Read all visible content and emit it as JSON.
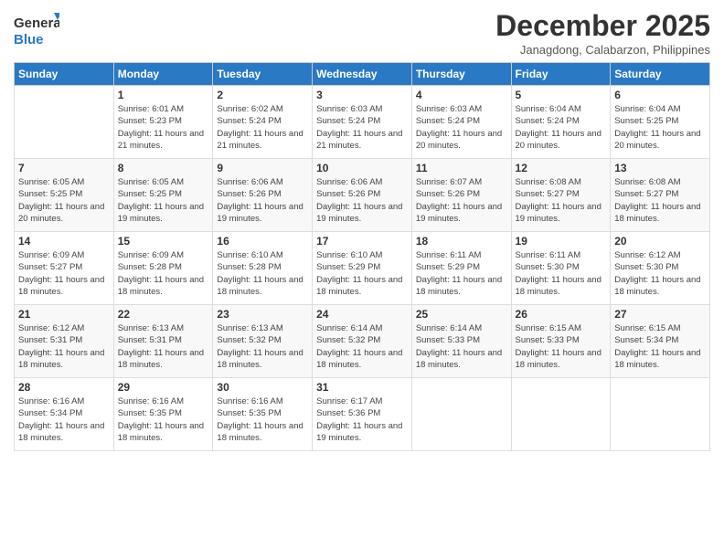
{
  "header": {
    "logo_general": "General",
    "logo_blue": "Blue",
    "month": "December 2025",
    "location": "Janagdong, Calabarzon, Philippines"
  },
  "days_of_week": [
    "Sunday",
    "Monday",
    "Tuesday",
    "Wednesday",
    "Thursday",
    "Friday",
    "Saturday"
  ],
  "weeks": [
    [
      {
        "day": "",
        "sunrise": "",
        "sunset": "",
        "daylight": ""
      },
      {
        "day": "1",
        "sunrise": "Sunrise: 6:01 AM",
        "sunset": "Sunset: 5:23 PM",
        "daylight": "Daylight: 11 hours and 21 minutes."
      },
      {
        "day": "2",
        "sunrise": "Sunrise: 6:02 AM",
        "sunset": "Sunset: 5:24 PM",
        "daylight": "Daylight: 11 hours and 21 minutes."
      },
      {
        "day": "3",
        "sunrise": "Sunrise: 6:03 AM",
        "sunset": "Sunset: 5:24 PM",
        "daylight": "Daylight: 11 hours and 21 minutes."
      },
      {
        "day": "4",
        "sunrise": "Sunrise: 6:03 AM",
        "sunset": "Sunset: 5:24 PM",
        "daylight": "Daylight: 11 hours and 20 minutes."
      },
      {
        "day": "5",
        "sunrise": "Sunrise: 6:04 AM",
        "sunset": "Sunset: 5:24 PM",
        "daylight": "Daylight: 11 hours and 20 minutes."
      },
      {
        "day": "6",
        "sunrise": "Sunrise: 6:04 AM",
        "sunset": "Sunset: 5:25 PM",
        "daylight": "Daylight: 11 hours and 20 minutes."
      }
    ],
    [
      {
        "day": "7",
        "sunrise": "Sunrise: 6:05 AM",
        "sunset": "Sunset: 5:25 PM",
        "daylight": "Daylight: 11 hours and 20 minutes."
      },
      {
        "day": "8",
        "sunrise": "Sunrise: 6:05 AM",
        "sunset": "Sunset: 5:25 PM",
        "daylight": "Daylight: 11 hours and 19 minutes."
      },
      {
        "day": "9",
        "sunrise": "Sunrise: 6:06 AM",
        "sunset": "Sunset: 5:26 PM",
        "daylight": "Daylight: 11 hours and 19 minutes."
      },
      {
        "day": "10",
        "sunrise": "Sunrise: 6:06 AM",
        "sunset": "Sunset: 5:26 PM",
        "daylight": "Daylight: 11 hours and 19 minutes."
      },
      {
        "day": "11",
        "sunrise": "Sunrise: 6:07 AM",
        "sunset": "Sunset: 5:26 PM",
        "daylight": "Daylight: 11 hours and 19 minutes."
      },
      {
        "day": "12",
        "sunrise": "Sunrise: 6:08 AM",
        "sunset": "Sunset: 5:27 PM",
        "daylight": "Daylight: 11 hours and 19 minutes."
      },
      {
        "day": "13",
        "sunrise": "Sunrise: 6:08 AM",
        "sunset": "Sunset: 5:27 PM",
        "daylight": "Daylight: 11 hours and 18 minutes."
      }
    ],
    [
      {
        "day": "14",
        "sunrise": "Sunrise: 6:09 AM",
        "sunset": "Sunset: 5:27 PM",
        "daylight": "Daylight: 11 hours and 18 minutes."
      },
      {
        "day": "15",
        "sunrise": "Sunrise: 6:09 AM",
        "sunset": "Sunset: 5:28 PM",
        "daylight": "Daylight: 11 hours and 18 minutes."
      },
      {
        "day": "16",
        "sunrise": "Sunrise: 6:10 AM",
        "sunset": "Sunset: 5:28 PM",
        "daylight": "Daylight: 11 hours and 18 minutes."
      },
      {
        "day": "17",
        "sunrise": "Sunrise: 6:10 AM",
        "sunset": "Sunset: 5:29 PM",
        "daylight": "Daylight: 11 hours and 18 minutes."
      },
      {
        "day": "18",
        "sunrise": "Sunrise: 6:11 AM",
        "sunset": "Sunset: 5:29 PM",
        "daylight": "Daylight: 11 hours and 18 minutes."
      },
      {
        "day": "19",
        "sunrise": "Sunrise: 6:11 AM",
        "sunset": "Sunset: 5:30 PM",
        "daylight": "Daylight: 11 hours and 18 minutes."
      },
      {
        "day": "20",
        "sunrise": "Sunrise: 6:12 AM",
        "sunset": "Sunset: 5:30 PM",
        "daylight": "Daylight: 11 hours and 18 minutes."
      }
    ],
    [
      {
        "day": "21",
        "sunrise": "Sunrise: 6:12 AM",
        "sunset": "Sunset: 5:31 PM",
        "daylight": "Daylight: 11 hours and 18 minutes."
      },
      {
        "day": "22",
        "sunrise": "Sunrise: 6:13 AM",
        "sunset": "Sunset: 5:31 PM",
        "daylight": "Daylight: 11 hours and 18 minutes."
      },
      {
        "day": "23",
        "sunrise": "Sunrise: 6:13 AM",
        "sunset": "Sunset: 5:32 PM",
        "daylight": "Daylight: 11 hours and 18 minutes."
      },
      {
        "day": "24",
        "sunrise": "Sunrise: 6:14 AM",
        "sunset": "Sunset: 5:32 PM",
        "daylight": "Daylight: 11 hours and 18 minutes."
      },
      {
        "day": "25",
        "sunrise": "Sunrise: 6:14 AM",
        "sunset": "Sunset: 5:33 PM",
        "daylight": "Daylight: 11 hours and 18 minutes."
      },
      {
        "day": "26",
        "sunrise": "Sunrise: 6:15 AM",
        "sunset": "Sunset: 5:33 PM",
        "daylight": "Daylight: 11 hours and 18 minutes."
      },
      {
        "day": "27",
        "sunrise": "Sunrise: 6:15 AM",
        "sunset": "Sunset: 5:34 PM",
        "daylight": "Daylight: 11 hours and 18 minutes."
      }
    ],
    [
      {
        "day": "28",
        "sunrise": "Sunrise: 6:16 AM",
        "sunset": "Sunset: 5:34 PM",
        "daylight": "Daylight: 11 hours and 18 minutes."
      },
      {
        "day": "29",
        "sunrise": "Sunrise: 6:16 AM",
        "sunset": "Sunset: 5:35 PM",
        "daylight": "Daylight: 11 hours and 18 minutes."
      },
      {
        "day": "30",
        "sunrise": "Sunrise: 6:16 AM",
        "sunset": "Sunset: 5:35 PM",
        "daylight": "Daylight: 11 hours and 18 minutes."
      },
      {
        "day": "31",
        "sunrise": "Sunrise: 6:17 AM",
        "sunset": "Sunset: 5:36 PM",
        "daylight": "Daylight: 11 hours and 19 minutes."
      },
      {
        "day": "",
        "sunrise": "",
        "sunset": "",
        "daylight": ""
      },
      {
        "day": "",
        "sunrise": "",
        "sunset": "",
        "daylight": ""
      },
      {
        "day": "",
        "sunrise": "",
        "sunset": "",
        "daylight": ""
      }
    ]
  ]
}
